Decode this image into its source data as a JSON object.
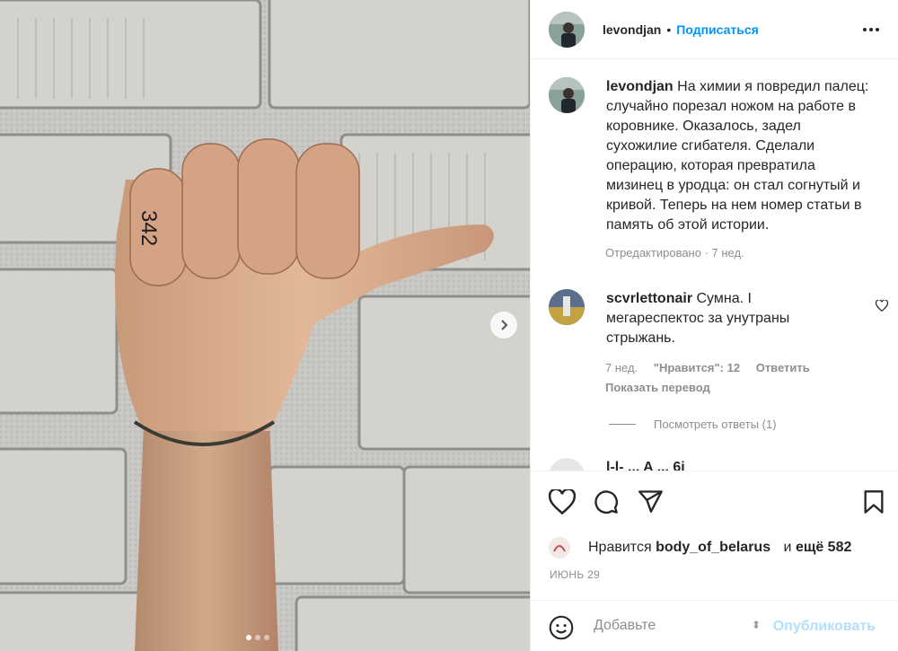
{
  "post": {
    "username": "levondjan",
    "follow_label": "Подписаться",
    "finger_number": "342",
    "carousel_dots": 3,
    "active_dot": 0
  },
  "caption": {
    "username": "levondjan",
    "text": "На химии я повредил палец: случайно порезал ножом на работе в коровнике. Оказалось, задел сухожилие сгибателя. Сделали операцию, которая превратила мизинец в уродца: он стал согнутый и кривой. Теперь на нем номер статьи в память об этой истории.",
    "meta": "Отредактировано · 7 нед."
  },
  "comment1": {
    "username": "scvrlettonair",
    "text": "Сумна. I мегареспектос за унутраны стрыжань.",
    "time": "7 нед.",
    "likes": "\"Нравится\": 12",
    "reply": "Ответить",
    "translate": "Показать перевод",
    "view_replies": "Посмотреть ответы (1)"
  },
  "comment2_partial": "l-l- ... A ... 6i",
  "likes": {
    "prefix": "Нравится",
    "user": "body_of_belarus",
    "conj": "и",
    "more": "ещё 582"
  },
  "date": "ИЮНЬ 29",
  "add_comment": {
    "placeholder": "Добавьте",
    "publish": "Опубликовать"
  },
  "colors": {
    "accent": "#0095f6",
    "publish_disabled": "#b2dffc",
    "secondary_text": "#8e8e8e"
  }
}
